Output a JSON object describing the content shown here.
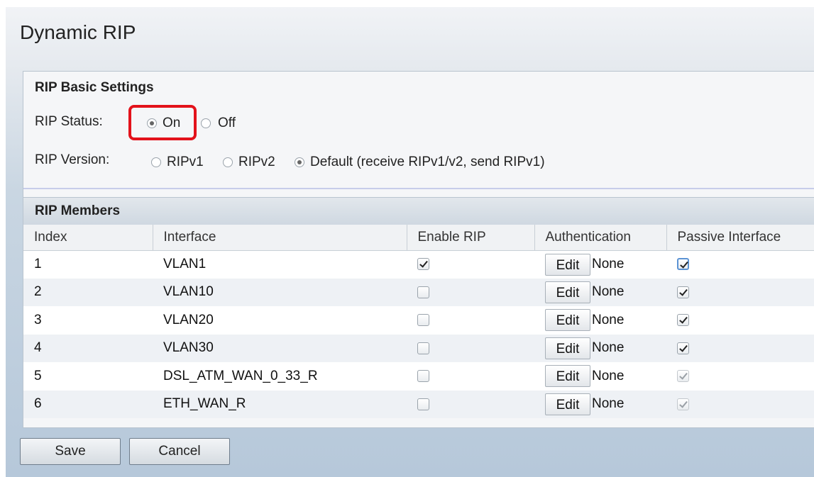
{
  "page": {
    "title": "Dynamic RIP"
  },
  "basic": {
    "title": "RIP Basic Settings",
    "status_label": "RIP Status:",
    "status_options": [
      "On",
      "Off"
    ],
    "status_selected": "On",
    "version_label": "RIP Version:",
    "version_options": [
      "RIPv1",
      "RIPv2",
      "Default (receive RIPv1/v2, send RIPv1)"
    ],
    "version_selected": "Default (receive RIPv1/v2, send RIPv1)"
  },
  "members": {
    "title": "RIP Members",
    "columns": [
      "Index",
      "Interface",
      "Enable RIP",
      "Authentication",
      "Passive Interface"
    ],
    "rows": [
      {
        "index": "1",
        "interface": "VLAN1",
        "enable_rip": true,
        "edit_label": "Edit",
        "authentication": "None",
        "passive": true,
        "passive_disabled": false
      },
      {
        "index": "2",
        "interface": "VLAN10",
        "enable_rip": false,
        "edit_label": "Edit",
        "authentication": "None",
        "passive": true,
        "passive_disabled": false
      },
      {
        "index": "3",
        "interface": "VLAN20",
        "enable_rip": false,
        "edit_label": "Edit",
        "authentication": "None",
        "passive": true,
        "passive_disabled": false
      },
      {
        "index": "4",
        "interface": "VLAN30",
        "enable_rip": false,
        "edit_label": "Edit",
        "authentication": "None",
        "passive": true,
        "passive_disabled": false
      },
      {
        "index": "5",
        "interface": "DSL_ATM_WAN_0_33_R",
        "enable_rip": false,
        "edit_label": "Edit",
        "authentication": "None",
        "passive": true,
        "passive_disabled": true
      },
      {
        "index": "6",
        "interface": "ETH_WAN_R",
        "enable_rip": false,
        "edit_label": "Edit",
        "authentication": "None",
        "passive": true,
        "passive_disabled": true
      }
    ]
  },
  "buttons": {
    "save": "Save",
    "cancel": "Cancel"
  },
  "colors": {
    "highlight": "#e3121b"
  }
}
